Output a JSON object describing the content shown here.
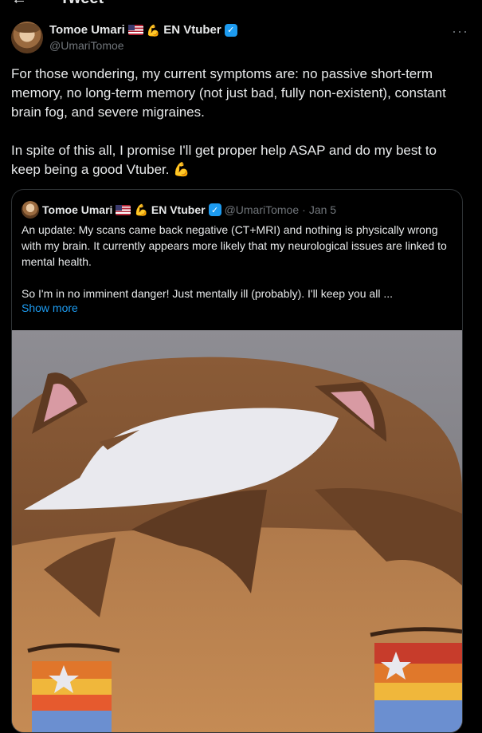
{
  "topbar": {
    "back": "←",
    "title": "Tweet"
  },
  "tweet": {
    "author_name": "Tomoe Umari",
    "author_suffix": "EN Vtuber",
    "handle": "@UmariTomoe",
    "more": "···",
    "text_p1": "For those wondering, my current symptoms are: no passive short-term memory, no long-term memory (not just bad, fully non-existent), constant brain fog, and severe migraines.",
    "text_p2": "In spite of this all, I promise I'll get proper help ASAP and do my best to keep being a good Vtuber. 💪"
  },
  "quote": {
    "author_name": "Tomoe Umari",
    "author_suffix": "EN Vtuber",
    "handle": "@UmariTomoe",
    "separator": "·",
    "date": "Jan 5",
    "text_p1": "An update: My scans came back negative (CT+MRI) and nothing is physically wrong with my brain. It currently appears more likely that my neurological issues are linked to mental health.",
    "text_p2": "So I'm in no imminent danger! Just mentally ill (probably). I'll keep you all ...",
    "show_more": "Show more"
  },
  "icons": {
    "flag": "us-flag-icon",
    "arm": "brown-arm-emoji-icon",
    "verified": "verified-badge-icon",
    "verified_glyph": "✓",
    "arm_glyph": "💪"
  },
  "colors": {
    "accent": "#1d9bf0",
    "background": "#000000",
    "muted": "#71767b",
    "border": "#2f3336"
  }
}
